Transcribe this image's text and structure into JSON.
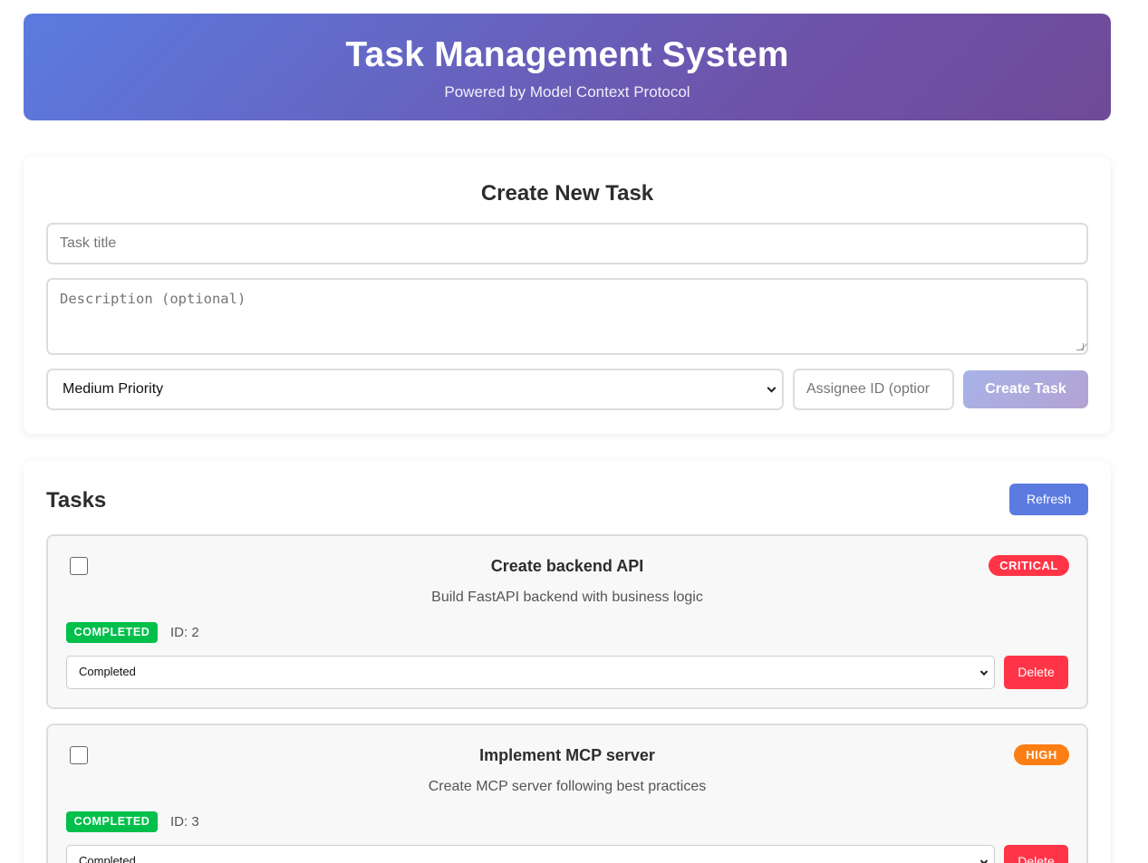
{
  "header": {
    "title": "Task Management System",
    "subtitle": "Powered by Model Context Protocol"
  },
  "create_form": {
    "heading": "Create New Task",
    "title_placeholder": "Task title",
    "description_placeholder": "Description (optional)",
    "priority_selected": "Medium Priority",
    "assignee_placeholder": "Assignee ID (optional)",
    "assignee_visible": "Assignee ID (optior",
    "submit_label": "Create Task"
  },
  "tasks_section": {
    "heading": "Tasks",
    "refresh_label": "Refresh",
    "delete_label": "Delete",
    "items": [
      {
        "title": "Create backend API",
        "priority": "CRITICAL",
        "description": "Build FastAPI backend with business logic",
        "status": "COMPLETED",
        "id_label": "ID: 2",
        "status_selected": "Completed"
      },
      {
        "title": "Implement MCP server",
        "priority": "HIGH",
        "description": "Create MCP server following best practices",
        "status": "COMPLETED",
        "id_label": "ID: 3",
        "status_selected": "Completed"
      }
    ]
  },
  "colors": {
    "header_gradient_start": "#5b7be0",
    "header_gradient_end": "#6f4a98",
    "critical": "#ff3547",
    "high": "#fd7e14",
    "completed": "#00c04b",
    "refresh": "#5b7be0",
    "delete": "#ff3547"
  }
}
